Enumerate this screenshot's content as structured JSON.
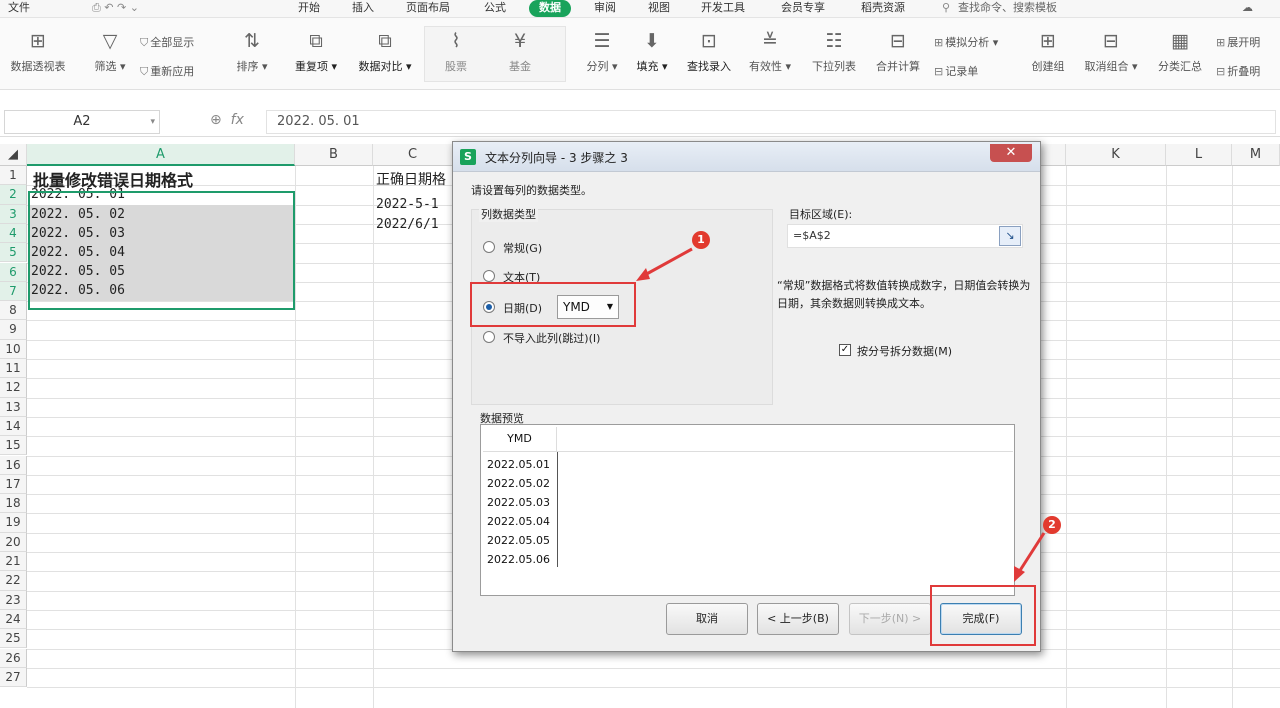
{
  "menu": {
    "items": [
      "文件",
      "开始",
      "插入",
      "页面布局",
      "公式",
      "数据",
      "审阅",
      "视图",
      "开发工具",
      "会员专享",
      "稻壳资源"
    ],
    "active": "数据",
    "search_placeholder": "查找命令、搜索模板"
  },
  "ribbon": {
    "pivot": "数据透视表",
    "filter": "筛选",
    "show_all": "全部显示",
    "reapply": "重新应用",
    "sort": "排序",
    "duplicates": "重复项",
    "compare": "数据对比",
    "stocks": "股票",
    "fund": "基金",
    "split": "分列",
    "fill": "填充",
    "lookup": "查找录入",
    "validity": "有效性",
    "dropdown": "下拉列表",
    "consolidate": "合并计算",
    "simulate": "模拟分析",
    "record": "记录单",
    "group": "创建组",
    "ungroup": "取消组合",
    "subtotal": "分类汇总",
    "expand": "展开明",
    "collapse": "折叠明"
  },
  "formula": {
    "namebox": "A2",
    "fx": "fx",
    "value": "2022. 05. 01"
  },
  "sheet": {
    "columns": [
      "A",
      "B",
      "C",
      "K",
      "L",
      "M"
    ],
    "rows": [
      "1",
      "2",
      "3",
      "4",
      "5",
      "6",
      "7",
      "8",
      "9",
      "10",
      "11",
      "12",
      "13",
      "14",
      "15",
      "16",
      "17",
      "18",
      "19",
      "20",
      "21",
      "22",
      "23",
      "24",
      "25",
      "26",
      "27"
    ],
    "a1": "批量修改错误日期格式",
    "a_values": [
      "2022. 05. 01",
      "2022. 05. 02",
      "2022. 05. 03",
      "2022. 05. 04",
      "2022. 05. 05",
      "2022. 05. 06"
    ],
    "c1": "正确日期格",
    "c_values": [
      "2022-5-1",
      "2022/6/1"
    ]
  },
  "dialog": {
    "title": "文本分列向导 - 3 步骤之 3",
    "instruction": "请设置每列的数据类型。",
    "group_label": "列数据类型",
    "opt_general": "常规(G)",
    "opt_text": "文本(T)",
    "opt_date": "日期(D)",
    "opt_skip": "不导入此列(跳过)(I)",
    "date_format": "YMD",
    "target_label": "目标区域(E):",
    "target_value": "=$A$2",
    "hint": "“常规”数据格式将数值转换成数字，日期值会转换为日期，其余数据则转换成文本。",
    "checkbox_label": "按分号拆分数据(M)",
    "preview_label": "数据预览",
    "preview_header": "YMD",
    "preview_values": [
      "2022.05.01",
      "2022.05.02",
      "2022.05.03",
      "2022.05.04",
      "2022.05.05",
      "2022.05.06"
    ],
    "btn_cancel": "取消",
    "btn_back": "< 上一步(B)",
    "btn_next": "下一步(N) >",
    "btn_finish": "完成(F)"
  },
  "annotations": {
    "badge1": "1",
    "badge2": "2",
    "color": "#e03a3a"
  }
}
